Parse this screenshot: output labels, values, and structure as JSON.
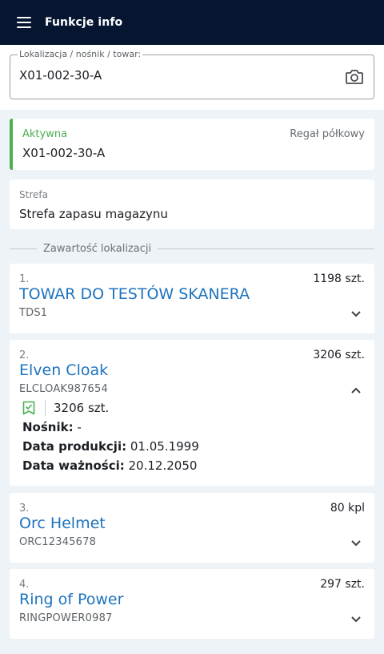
{
  "appbar": {
    "title": "Funkcje info",
    "menu_icon": "hamburger-icon"
  },
  "search": {
    "label": "Lokalizacja / nośnik / towar:",
    "value": "X01-002-30-A",
    "placeholder": "",
    "scan_icon": "camera-icon"
  },
  "location": {
    "status": "Aktywna",
    "status_color": "#4caf50",
    "type": "Regał półkowy",
    "code": "X01-002-30-A"
  },
  "zone": {
    "label": "Strefa",
    "value": "Strefa zapasu magazynu"
  },
  "contents": {
    "title": "Zawartość lokalizacji",
    "items": [
      {
        "num": "1.",
        "name": "TOWAR DO TESTÓW SKANERA",
        "code": "TDS1",
        "qty": "1198 szt.",
        "expanded": false
      },
      {
        "num": "2.",
        "name": "Elven Cloak",
        "code": "ELCLOAK987654",
        "qty": "3206 szt.",
        "expanded": true,
        "details": {
          "qty": "3206 szt.",
          "carrier_label": "Nośnik:",
          "carrier_value": " -",
          "prod_label": "Data produkcji:",
          "prod_value": " 01.05.1999",
          "exp_label": "Data ważności:",
          "exp_value": " 20.12.2050"
        }
      },
      {
        "num": "3.",
        "name": "Orc Helmet",
        "code": "ORC12345678",
        "qty": "80 kpl",
        "expanded": false
      },
      {
        "num": "4.",
        "name": "Ring of Power",
        "code": "RINGPOWER0987",
        "qty": "297 szt.",
        "expanded": false
      }
    ]
  },
  "colors": {
    "appbar": "#061631",
    "accent": "#1e73be",
    "active": "#4caf50",
    "background": "#eef3f8"
  }
}
